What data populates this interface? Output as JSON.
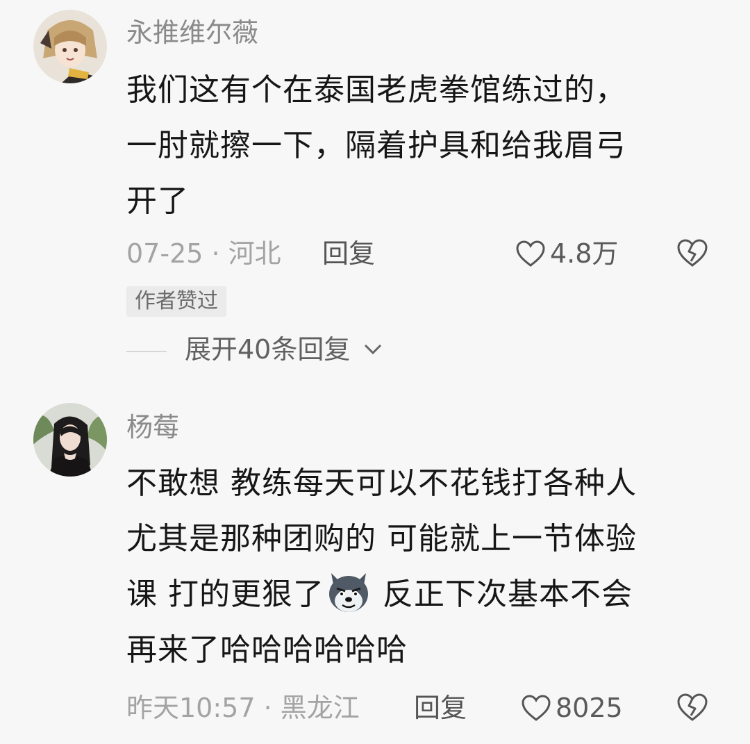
{
  "comments": [
    {
      "username": "永推维尔薇",
      "lines": [
        "我们这有个在泰国老虎拳馆练过的，",
        "一肘就擦一下，隔着护具和给我眉弓",
        "开了"
      ],
      "date_location": "07-25 · 河北",
      "reply_label": "回复",
      "like_count": "4.8万",
      "author_badge": "作者赞过",
      "expand_label": "展开40条回复"
    },
    {
      "username": "杨莓",
      "lines": [
        "不敢想 教练每天可以不花钱打各种人",
        "尤其是那种团购的 可能就上一节体验",
        "课 打的更狠了",
        "反正下次基本不会",
        "再来了哈哈哈哈哈哈"
      ],
      "emoji_icon": "wolf-face-emoji",
      "date_location": "昨天10:57 · 黑龙江",
      "reply_label": "回复",
      "like_count": "8025"
    }
  ],
  "colors": {
    "background": "#f7f7f7",
    "text": "#161616",
    "meta": "#a3a3a3"
  }
}
